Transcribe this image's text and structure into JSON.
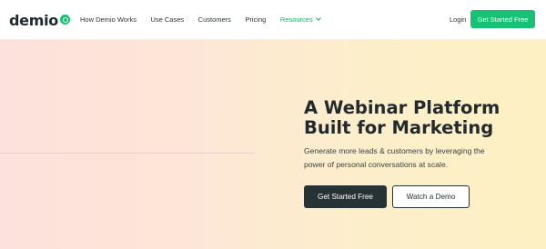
{
  "nav": {
    "logo_text": "demio",
    "links": [
      {
        "label": "How Demio Works"
      },
      {
        "label": "Use Cases"
      },
      {
        "label": "Customers"
      },
      {
        "label": "Pricing"
      },
      {
        "label": "Resources"
      }
    ],
    "login_label": "Login",
    "cta_label": "Get Started Free"
  },
  "hero": {
    "headline_line1": "A Webinar Platform",
    "headline_line2": "Built for Marketing",
    "subtext_line1": "Generate more leads & customers by leveraging the",
    "subtext_line2": "power of personal conversations at scale.",
    "primary_button": "Get Started Free",
    "secondary_button": "Watch a Demo"
  },
  "colors": {
    "brand_green": "#17c274",
    "dark": "#273235",
    "hero_gradient_start": "#fde1dc",
    "hero_gradient_end": "#fdf1c3"
  },
  "icons": {
    "logo_mark": "demio-logo-icon",
    "resources_chevron": "chevron-down-icon"
  }
}
